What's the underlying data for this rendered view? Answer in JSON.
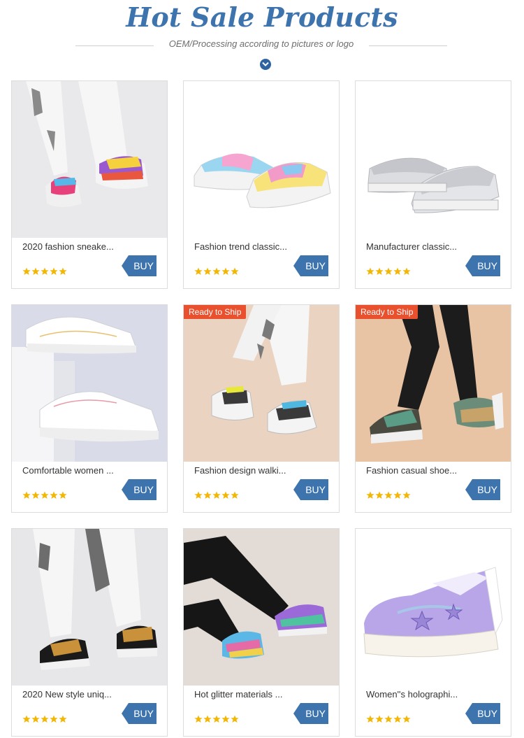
{
  "header": {
    "title": "Hot Sale Products",
    "subtitle": "OEM/Processing according to pictures or logo"
  },
  "colors": {
    "accent": "#3d74ad",
    "badge": "#e8502e",
    "star": "#f2b705"
  },
  "products": [
    {
      "name": "2020 fashion sneake...",
      "buy": "BUY",
      "rating": 5,
      "badge": "",
      "image": "legs-camo-rainbow-chunky-sneakers"
    },
    {
      "name": "Fashion trend classic...",
      "buy": "BUY",
      "rating": 5,
      "badge": "",
      "image": "tie-dye-platform-sneakers"
    },
    {
      "name": "Manufacturer classic...",
      "buy": "BUY",
      "rating": 5,
      "badge": "",
      "image": "silver-platform-sneakers"
    },
    {
      "name": "Comfortable women ...",
      "buy": "BUY",
      "rating": 5,
      "badge": "",
      "image": "white-sneakers-on-stand"
    },
    {
      "name": "Fashion design walki...",
      "buy": "BUY",
      "rating": 5,
      "badge": "Ready to Ship",
      "image": "legs-camo-white-sneakers"
    },
    {
      "name": "Fashion casual shoe...",
      "buy": "BUY",
      "rating": 5,
      "badge": "Ready to Ship",
      "image": "black-leggings-green-sneakers"
    },
    {
      "name": "2020 New style uniq...",
      "buy": "BUY",
      "rating": 5,
      "badge": "",
      "image": "legs-leopard-sneakers"
    },
    {
      "name": "Hot glitter materials ...",
      "buy": "BUY",
      "rating": 5,
      "badge": "",
      "image": "rainbow-glitter-sneakers"
    },
    {
      "name": "Women''s holographi...",
      "buy": "BUY",
      "rating": 5,
      "badge": "",
      "image": "holographic-star-sneaker"
    }
  ]
}
